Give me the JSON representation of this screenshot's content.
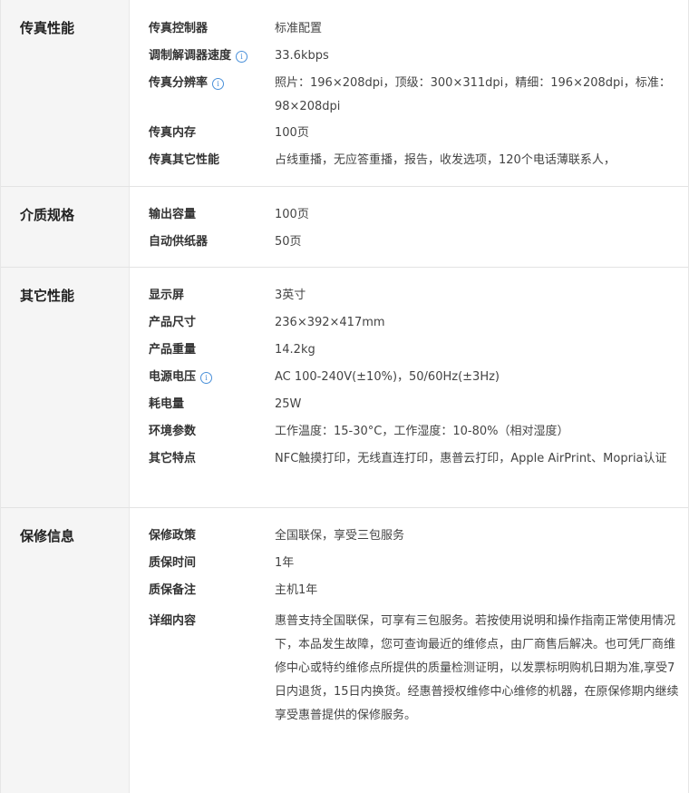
{
  "sections": [
    {
      "category": "传真性能",
      "rows": [
        {
          "label": "传真控制器",
          "value": "标准配置"
        },
        {
          "label": "调制解调器速度",
          "value": "33.6kbps",
          "info_icon": true
        },
        {
          "label": "传真分辨率",
          "value": "照片：196×208dpi，顶级：300×311dpi，精细：196×208dpi，标准：98×208dpi",
          "info_icon": true
        },
        {
          "label": "传真内存",
          "value": "100页"
        },
        {
          "label": "传真其它性能",
          "value": "占线重播，无应答重播，报告，收发选项，120个电话薄联系人，"
        }
      ]
    },
    {
      "category": "介质规格",
      "rows": [
        {
          "label": "输出容量",
          "value": "100页"
        },
        {
          "label": "自动供纸器",
          "value": "50页"
        }
      ]
    },
    {
      "category": "其它性能",
      "rows": [
        {
          "label": "显示屏",
          "value": "3英寸"
        },
        {
          "label": "产品尺寸",
          "value": "236×392×417mm"
        },
        {
          "label": "产品重量",
          "value": "14.2kg"
        },
        {
          "label": "电源电压",
          "value": "AC 100-240V(±10%)，50/60Hz(±3Hz)",
          "info_icon": true
        },
        {
          "label": "耗电量",
          "value": "25W"
        },
        {
          "label": "环境参数",
          "value": "工作温度：15-30°C，工作湿度：10-80%（相对湿度）"
        },
        {
          "label": "其它特点",
          "value": "NFC触摸打印，无线直连打印，惠普云打印，Apple AirPrint、Mopria认证"
        }
      ]
    },
    {
      "category": "保修信息",
      "rows": [
        {
          "label": "保修政策",
          "value": "全国联保，享受三包服务"
        },
        {
          "label": "质保时间",
          "value": "1年"
        },
        {
          "label": "质保备注",
          "value": "主机1年"
        },
        {
          "label": "详细内容",
          "value": "惠普支持全国联保，可享有三包服务。若按使用说明和操作指南正常使用情况下，本品发生故障，您可查询最近的维修点，由厂商售后解决。也可凭厂商维修中心或特约维修点所提供的质量检测证明，以发票标明购机日期为准,享受7日内退货，15日内换货。经惠普授权维修中心维修的机器，在原保修期内继续享受惠普提供的保修服务。"
        }
      ]
    }
  ],
  "info_icon_glyph": "i",
  "accent_color": "#4a90d9"
}
